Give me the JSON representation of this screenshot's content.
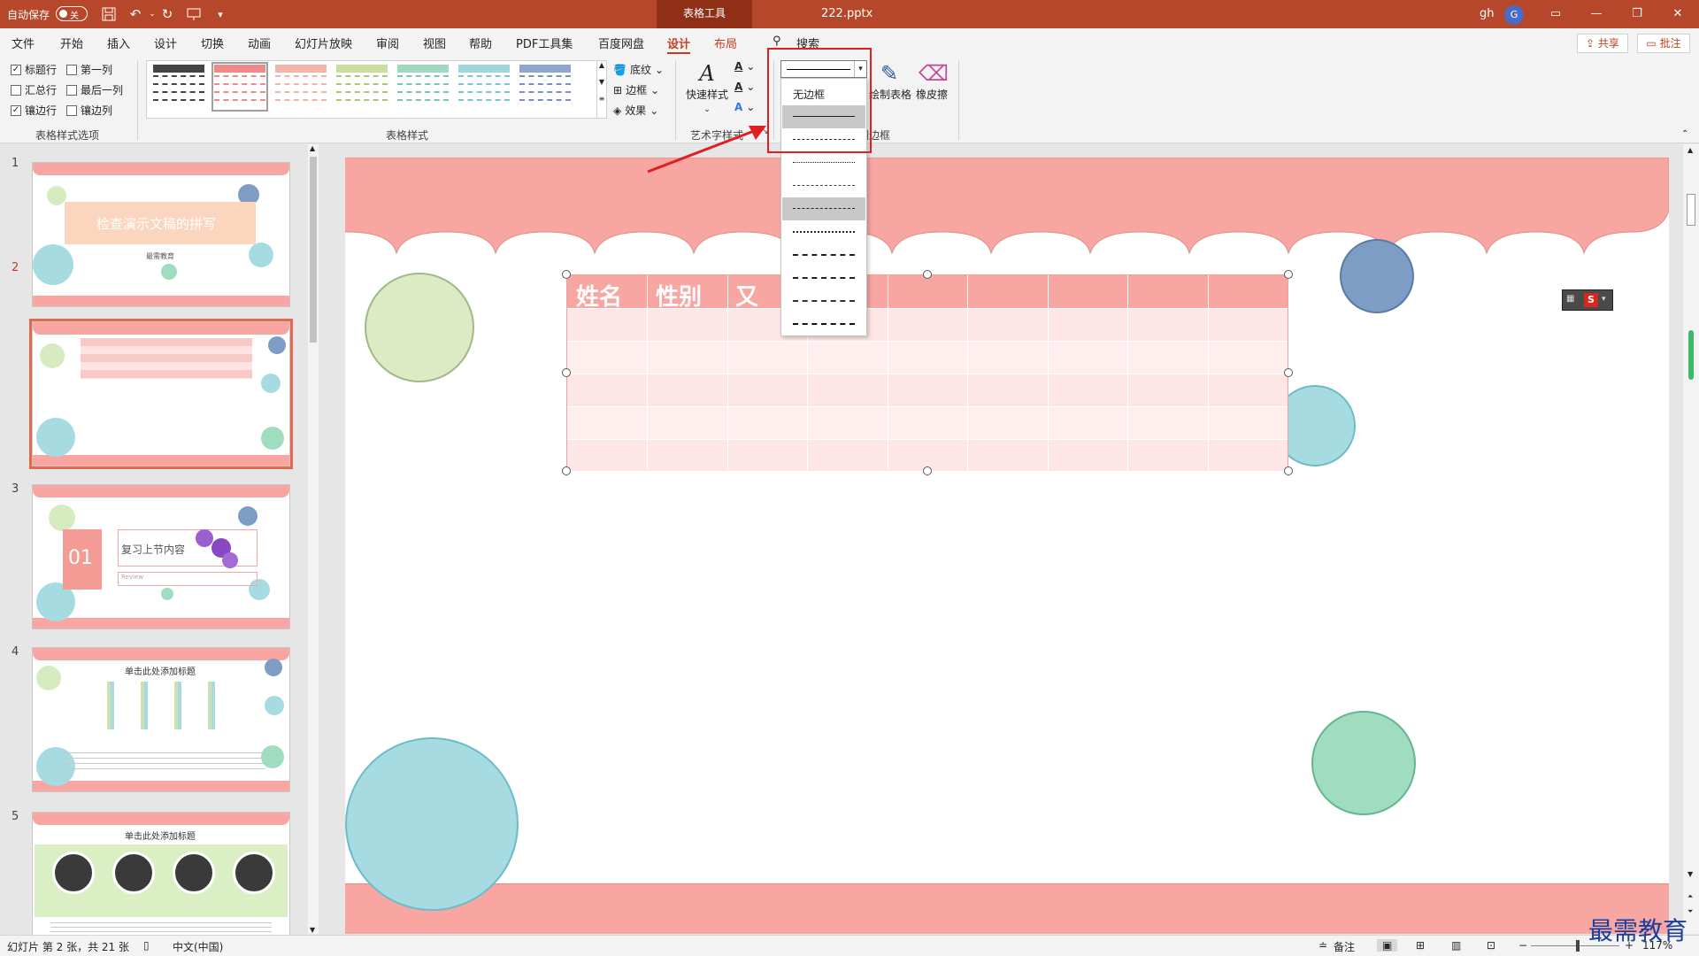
{
  "titlebar": {
    "autosave_label": "自动保存",
    "autosave_state": "关",
    "context_tool": "表格工具",
    "doc_title": "222.pptx",
    "user": "gh",
    "avatar_letter": "G",
    "brand_color": "#b7472a"
  },
  "tabs": [
    "文件",
    "开始",
    "插入",
    "设计",
    "切换",
    "动画",
    "幻灯片放映",
    "审阅",
    "视图",
    "帮助",
    "PDF工具集",
    "百度网盘",
    "设计",
    "布局"
  ],
  "active_tab": "设计",
  "search_label": "搜索",
  "share_label": "共享",
  "comment_label": "批注",
  "ribbon": {
    "style_options": {
      "items": [
        {
          "label": "标题行",
          "checked": true
        },
        {
          "label": "第一列",
          "checked": false
        },
        {
          "label": "汇总行",
          "checked": false
        },
        {
          "label": "最后一列",
          "checked": false
        },
        {
          "label": "镶边行",
          "checked": true
        },
        {
          "label": "镶边列",
          "checked": false
        }
      ],
      "group_label": "表格样式选项"
    },
    "table_styles": {
      "group_label": "表格样式",
      "shading": "底纹",
      "borders": "边框",
      "effects": "效果"
    },
    "wordart": {
      "group_label": "艺术字样式",
      "quick_styles": "快速样式"
    },
    "borders": {
      "group_label": "绘制边框",
      "draw_table": "绘制表格",
      "eraser": "橡皮擦"
    }
  },
  "pen_menu": {
    "no_border": "无边框",
    "styles": [
      "solid",
      "dashed",
      "dotted-fine",
      "dash-dot-fine",
      "dash-dot-dot",
      "dotted",
      "dash",
      "long-dash-dot",
      "long-dash-dot-dot",
      "long-dash-dot-long"
    ],
    "highlighted_index": 0
  },
  "thumbnails": [
    {
      "number": "1",
      "title": "检查演示文稿的拼写",
      "subtitle": "最需教育"
    },
    {
      "number": "2"
    },
    {
      "number": "3",
      "tag": "01",
      "title": "复习上节内容",
      "subtitle": "Review"
    },
    {
      "number": "4",
      "title": "单击此处添加标题"
    },
    {
      "number": "5",
      "title": "单击此处添加标题"
    }
  ],
  "table": {
    "headers": [
      "姓名",
      "性别",
      "又"
    ]
  },
  "statusbar": {
    "slide_info": "幻灯片 第 2 张，共 21 张",
    "language": "中文(中国)",
    "notes": "备注",
    "zoom": "117%"
  },
  "watermark": "最需教育"
}
